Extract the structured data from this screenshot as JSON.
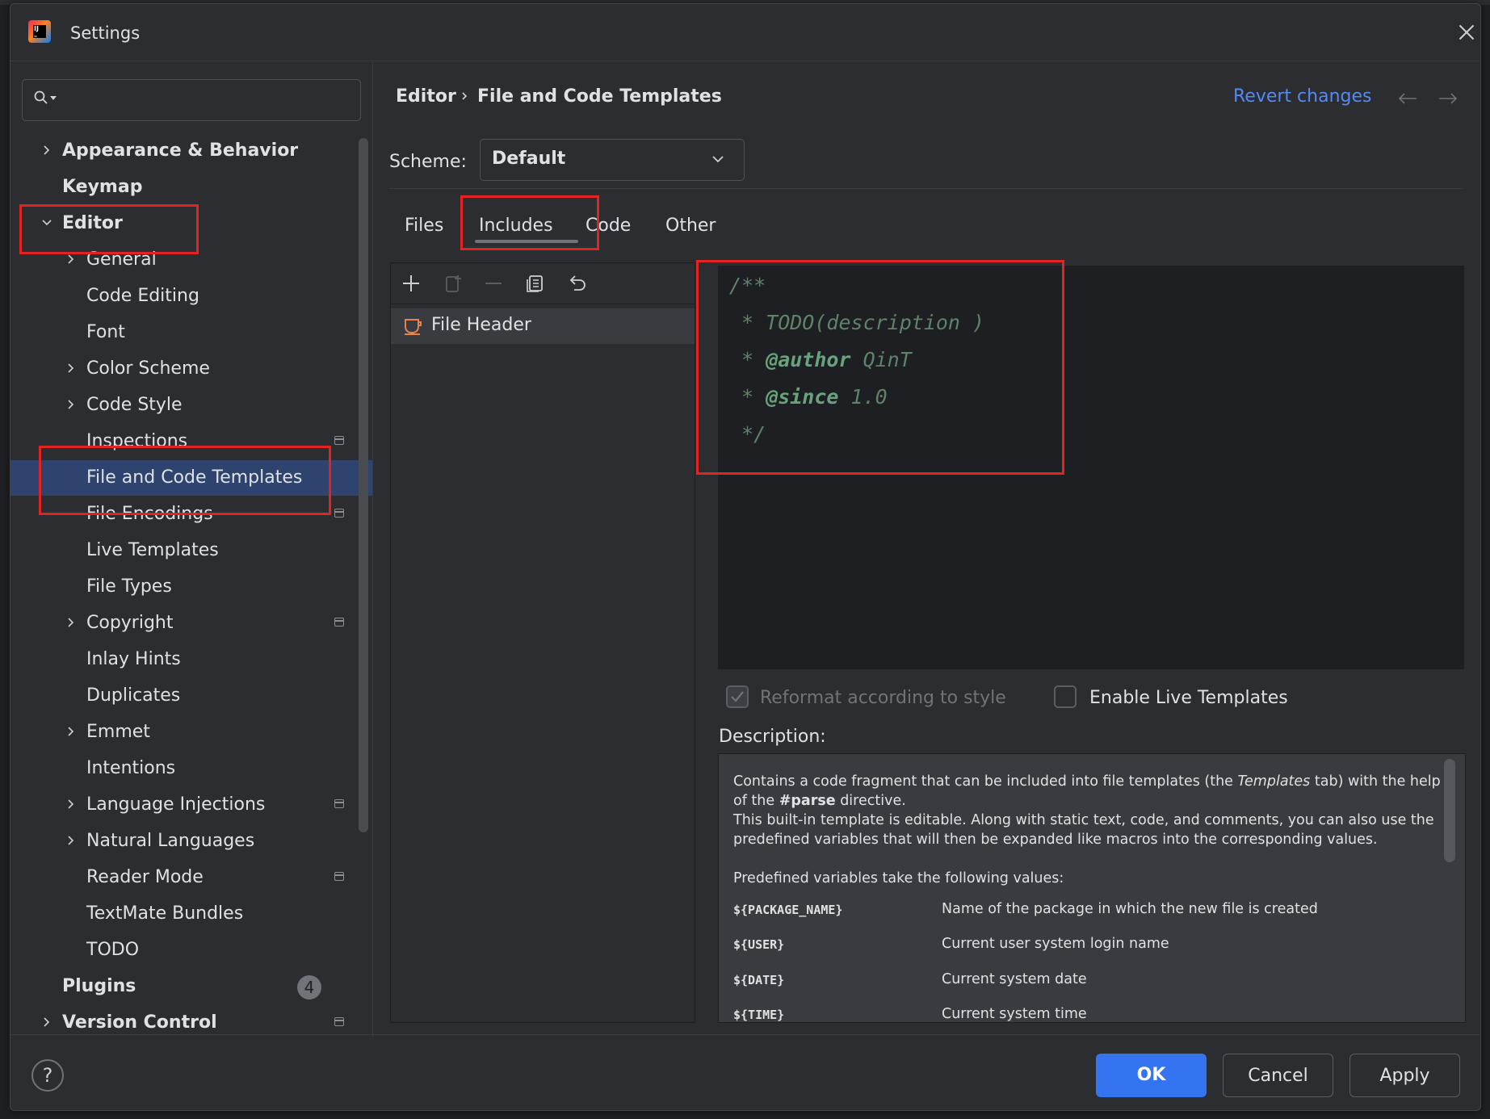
{
  "window": {
    "title": "Settings"
  },
  "search": {
    "placeholder": ""
  },
  "nav": {
    "items": [
      {
        "label": "Appearance & Behavior",
        "level": 0,
        "expandable": true,
        "expanded": false
      },
      {
        "label": "Keymap",
        "level": 0,
        "expandable": false
      },
      {
        "label": "Editor",
        "level": 0,
        "expandable": true,
        "expanded": true
      },
      {
        "label": "General",
        "level": 1,
        "expandable": true
      },
      {
        "label": "Code Editing",
        "level": 1
      },
      {
        "label": "Font",
        "level": 1
      },
      {
        "label": "Color Scheme",
        "level": 1,
        "expandable": true
      },
      {
        "label": "Code Style",
        "level": 1,
        "expandable": true
      },
      {
        "label": "Inspections",
        "level": 1,
        "project_icon": true
      },
      {
        "label": "File and Code Templates",
        "level": 1,
        "selected": true
      },
      {
        "label": "File Encodings",
        "level": 1,
        "project_icon": true
      },
      {
        "label": "Live Templates",
        "level": 1
      },
      {
        "label": "File Types",
        "level": 1
      },
      {
        "label": "Copyright",
        "level": 1,
        "expandable": true,
        "project_icon": true
      },
      {
        "label": "Inlay Hints",
        "level": 1
      },
      {
        "label": "Duplicates",
        "level": 1
      },
      {
        "label": "Emmet",
        "level": 1,
        "expandable": true
      },
      {
        "label": "Intentions",
        "level": 1
      },
      {
        "label": "Language Injections",
        "level": 1,
        "expandable": true,
        "project_icon": true
      },
      {
        "label": "Natural Languages",
        "level": 1,
        "expandable": true
      },
      {
        "label": "Reader Mode",
        "level": 1,
        "project_icon": true
      },
      {
        "label": "TextMate Bundles",
        "level": 1
      },
      {
        "label": "TODO",
        "level": 1
      },
      {
        "label": "Plugins",
        "level": 0,
        "badge": "4"
      },
      {
        "label": "Version Control",
        "level": 0,
        "expandable": true,
        "project_icon": true
      }
    ]
  },
  "breadcrumb": {
    "parent": "Editor",
    "current": "File and Code Templates"
  },
  "header": {
    "revert_label": "Revert changes"
  },
  "scheme": {
    "label": "Scheme:",
    "value": "Default"
  },
  "tabs": [
    {
      "label": "Files"
    },
    {
      "label": "Includes",
      "active": true
    },
    {
      "label": "Code"
    },
    {
      "label": "Other"
    }
  ],
  "templates": {
    "items": [
      {
        "label": "File Header"
      }
    ]
  },
  "editor": {
    "lines": [
      "/**",
      " * TODO(description )",
      " * @author QinT",
      " * @since 1.0",
      " */"
    ]
  },
  "options": {
    "reformat_label": "Reformat according to style",
    "reformat_checked": true,
    "live_templates_label": "Enable Live Templates",
    "live_templates_checked": false
  },
  "description": {
    "label": "Description:",
    "p1_a": "Contains a code fragment that can be included into file templates (the ",
    "p1_templates": "Templates",
    "p1_b": " tab) with the help of the ",
    "p1_parse": "#parse",
    "p1_c": " directive.",
    "p2": "This built-in template is editable. Along with static text, code, and comments, you can also use the predefined variables that will then be expanded like macros into the corresponding values.",
    "p3": "Predefined variables take the following values:",
    "vars": [
      {
        "name": "${PACKAGE_NAME}",
        "value": "Name of the package in which the new file is created"
      },
      {
        "name": "${USER}",
        "value": "Current user system login name"
      },
      {
        "name": "${DATE}",
        "value": "Current system date"
      },
      {
        "name": "${TIME}",
        "value": "Current system time"
      }
    ]
  },
  "footer": {
    "help_label": "?",
    "ok_label": "OK",
    "cancel_label": "Cancel",
    "apply_label": "Apply"
  },
  "colors": {
    "accent": "#3574f0",
    "link": "#548af7",
    "selection": "#2e436e",
    "annotation": "#e32222"
  }
}
